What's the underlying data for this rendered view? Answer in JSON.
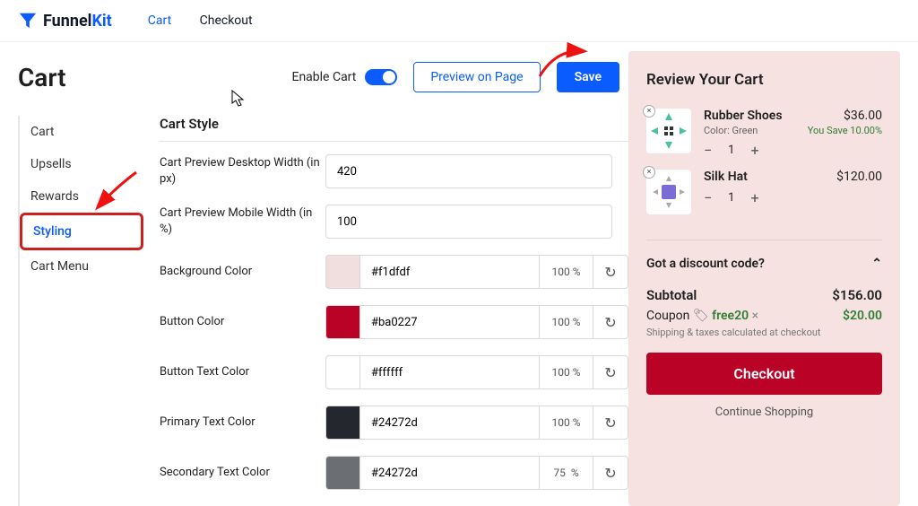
{
  "brand": {
    "part1": "Funnel",
    "part2": "Kit"
  },
  "topnav": {
    "cart": "Cart",
    "checkout": "Checkout"
  },
  "page": {
    "title": "Cart"
  },
  "header": {
    "enable": "Enable Cart",
    "preview": "Preview on Page",
    "save": "Save"
  },
  "sidebar": {
    "items": [
      "Cart",
      "Upsells",
      "Rewards",
      "Styling",
      "Cart Menu"
    ]
  },
  "section": {
    "title": "Cart Style"
  },
  "form": {
    "desktop_width": {
      "label": "Cart Preview Desktop Width (in px)",
      "value": "420"
    },
    "mobile_width": {
      "label": "Cart Preview Mobile Width (in %)",
      "value": "100"
    },
    "bg_color": {
      "label": "Background Color",
      "hex": "#f1dfdf",
      "pct": "100 %"
    },
    "btn_color": {
      "label": "Button Color",
      "hex": "#ba0227",
      "pct": "100 %"
    },
    "btn_text_color": {
      "label": "Button Text Color",
      "hex": "#ffffff",
      "pct": "100 %"
    },
    "primary_text": {
      "label": "Primary Text Color",
      "hex": "#24272d",
      "pct": "100 %"
    },
    "secondary_text": {
      "label": "Secondary Text Color",
      "hex": "#24272d",
      "pct": "75  %"
    }
  },
  "preview": {
    "title": "Review Your Cart",
    "items": [
      {
        "name": "Rubber Shoes",
        "sub": "Color: Green",
        "price": "$36.00",
        "save": "You Save 10.00%",
        "qty": "1"
      },
      {
        "name": "Silk Hat",
        "sub": "",
        "price": "$120.00",
        "save": "",
        "qty": "1"
      }
    ],
    "discount": "Got a discount code?",
    "subtotal_label": "Subtotal",
    "subtotal": "$156.00",
    "coupon_label": "Coupon",
    "coupon_code": "free20",
    "coupon_amt": "$20.00",
    "ship": "Shipping & taxes calculated at checkout",
    "checkout": "Checkout",
    "continue": "Continue Shopping"
  }
}
